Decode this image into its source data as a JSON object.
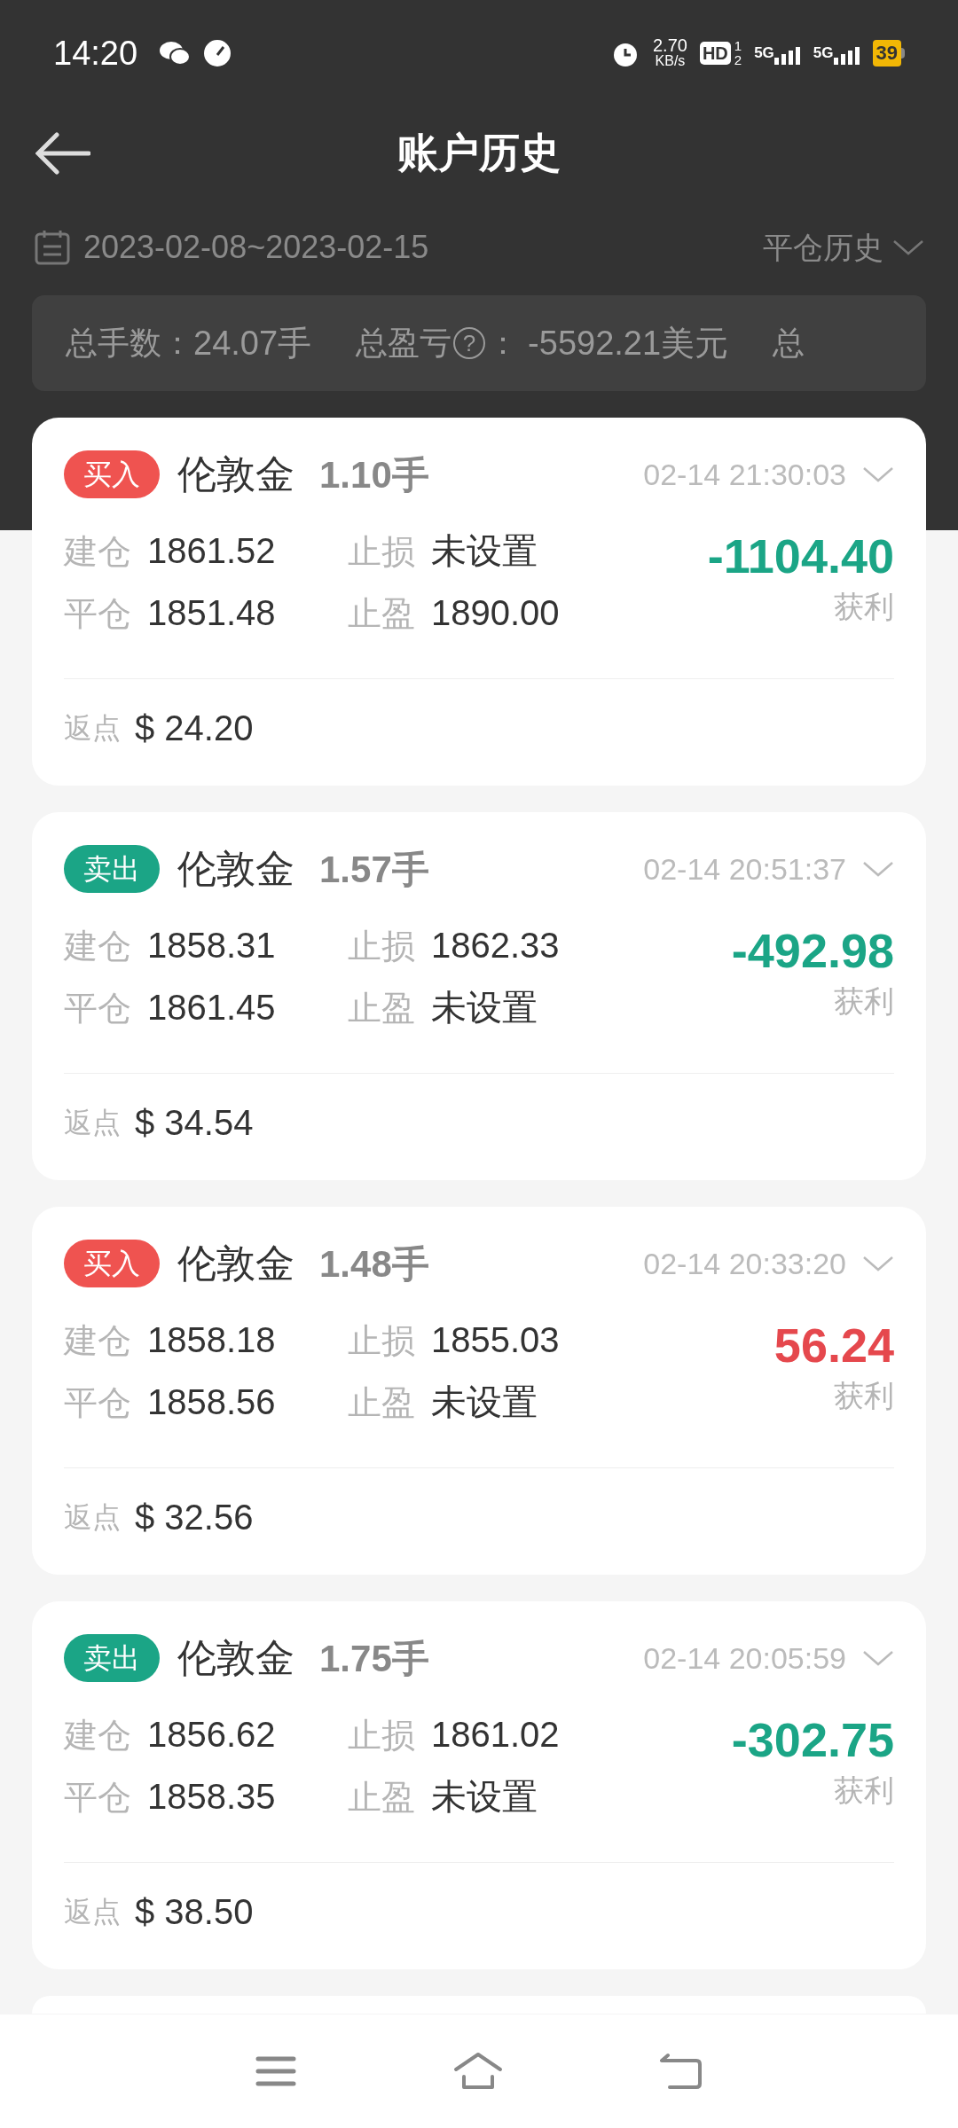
{
  "status_bar": {
    "time": "14:20",
    "net_speed": "2.70",
    "net_unit": "KB/s",
    "hd": "HD",
    "hd_sup": "1",
    "hd_sub": "2",
    "sim1": "5G",
    "sim2": "5G",
    "battery": "39"
  },
  "header": {
    "title": "账户历史"
  },
  "filter": {
    "date_range": "2023-02-08~2023-02-15",
    "mode": "平仓历史"
  },
  "summary": [
    {
      "label": "总手数：",
      "value": "24.07手"
    },
    {
      "label": "总盈亏",
      "value": "-5592.21美元",
      "help_text": "?",
      "colon": "："
    },
    {
      "label": "总"
    }
  ],
  "trades": [
    {
      "side": "买入",
      "kind": "buy",
      "symbol": "伦敦金",
      "lots": "1.10手",
      "time": "02-14 21:30:03",
      "open_label": "建仓",
      "open": "1861.52",
      "close_label": "平仓",
      "close": "1851.48",
      "sl_label": "止损",
      "sl": "未设置",
      "tp_label": "止盈",
      "tp": "1890.00",
      "profit": "-1104.40",
      "color": "#1ba586",
      "profit_label": "获利",
      "rebate_label": "返点",
      "rebate": "$ 24.20"
    },
    {
      "side": "卖出",
      "kind": "sell",
      "symbol": "伦敦金",
      "lots": "1.57手",
      "time": "02-14 20:51:37",
      "open_label": "建仓",
      "open": "1858.31",
      "close_label": "平仓",
      "close": "1861.45",
      "sl_label": "止损",
      "sl": "1862.33",
      "tp_label": "止盈",
      "tp": "未设置",
      "profit": "-492.98",
      "color": "#1ba586",
      "profit_label": "获利",
      "rebate_label": "返点",
      "rebate": "$ 34.54"
    },
    {
      "side": "买入",
      "kind": "buy",
      "symbol": "伦敦金",
      "lots": "1.48手",
      "time": "02-14 20:33:20",
      "open_label": "建仓",
      "open": "1858.18",
      "close_label": "平仓",
      "close": "1858.56",
      "sl_label": "止损",
      "sl": "1855.03",
      "tp_label": "止盈",
      "tp": "未设置",
      "profit": "56.24",
      "color": "#e5484d",
      "profit_label": "获利",
      "rebate_label": "返点",
      "rebate": "$ 32.56"
    },
    {
      "side": "卖出",
      "kind": "sell",
      "symbol": "伦敦金",
      "lots": "1.75手",
      "time": "02-14 20:05:59",
      "open_label": "建仓",
      "open": "1856.62",
      "close_label": "平仓",
      "close": "1858.35",
      "sl_label": "止损",
      "sl": "1861.02",
      "tp_label": "止盈",
      "tp": "未设置",
      "profit": "-302.75",
      "color": "#1ba586",
      "profit_label": "获利",
      "rebate_label": "返点",
      "rebate": "$ 38.50"
    }
  ]
}
